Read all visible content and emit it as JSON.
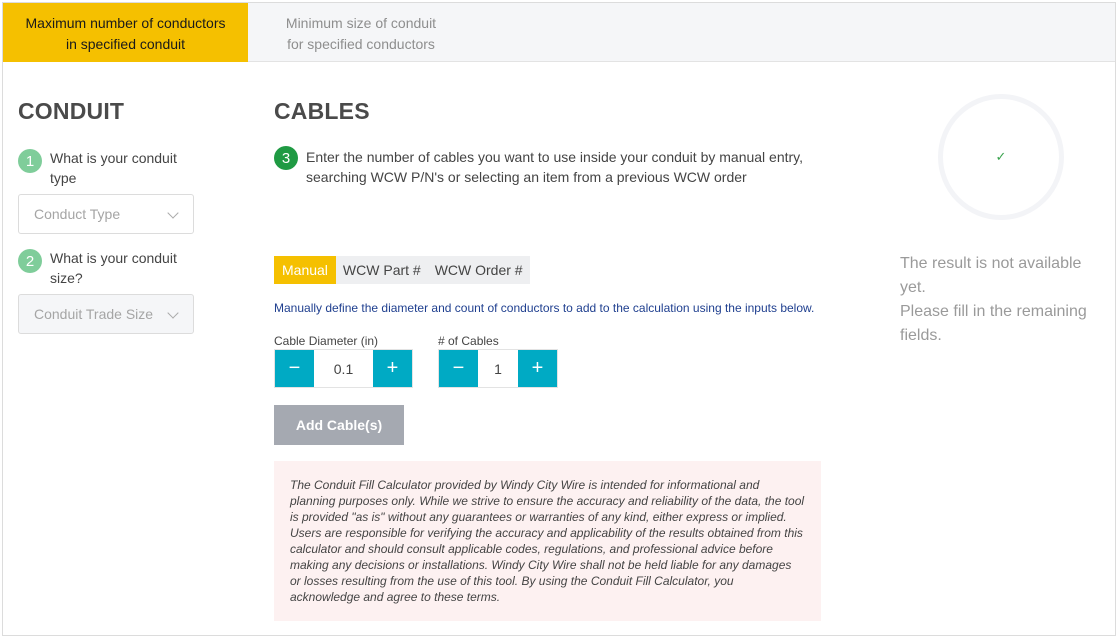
{
  "tabs": {
    "max_conductors": "Maximum number of conductors in specified conduit",
    "min_size": "Minimum size of conduit for specified conductors"
  },
  "conduit": {
    "heading": "CONDUIT",
    "step1_num": "1",
    "step1_question": "What is your conduit type",
    "type_placeholder": "Conduct Type",
    "step2_num": "2",
    "step2_question": "What is your conduit size?",
    "size_placeholder": "Conduit Trade Size"
  },
  "cables": {
    "heading": "CABLES",
    "step3_num": "3",
    "step3_text": "Enter the number of cables you want to use inside your conduit by manual entry, searching WCW P/N's or selecting an item from a previous WCW order",
    "modes": [
      "Manual",
      "WCW Part #",
      "WCW Order #"
    ],
    "hint": "Manually define the diameter and count of conductors to add to the calculation using the inputs below.",
    "diameter_label": "Cable Diameter (in)",
    "diameter_value": "0.1",
    "count_label": "# of Cables",
    "count_value": "1",
    "minus_glyph": "−",
    "plus_glyph": "+",
    "add_label": "Add Cable(s)",
    "disclaimer": "The Conduit Fill Calculator provided by Windy City Wire is intended for informational and planning purposes only. While we strive to ensure the accuracy and reliability of the data, the tool is provided \"as is\" without any guarantees or warranties of any kind, either express or implied. Users are responsible for verifying the accuracy and applicability of the results obtained from this calculator and should consult applicable codes, regulations, and professional advice before making any decisions or installations. Windy City Wire shall not be held liable for any damages or losses resulting from the use of this tool. By using the Conduit Fill Calculator, you acknowledge and agree to these terms."
  },
  "result": {
    "check_glyph": "✓",
    "line1": "The result is not available yet.",
    "line2": "Please fill in the remaining fields."
  },
  "colors": {
    "accent": "#f5c000",
    "step_light": "#7fcd9a",
    "step_dark": "#1f9a43",
    "stepper": "#00aac4",
    "button_disabled": "#a5a9b1",
    "disclaimer_bg": "#fdf1f1",
    "hint_text": "#1f3f8f"
  },
  "icons": {
    "select_chevron": "chevron-down-icon",
    "minus": "minus-icon",
    "plus": "plus-icon",
    "result": "check-icon"
  }
}
